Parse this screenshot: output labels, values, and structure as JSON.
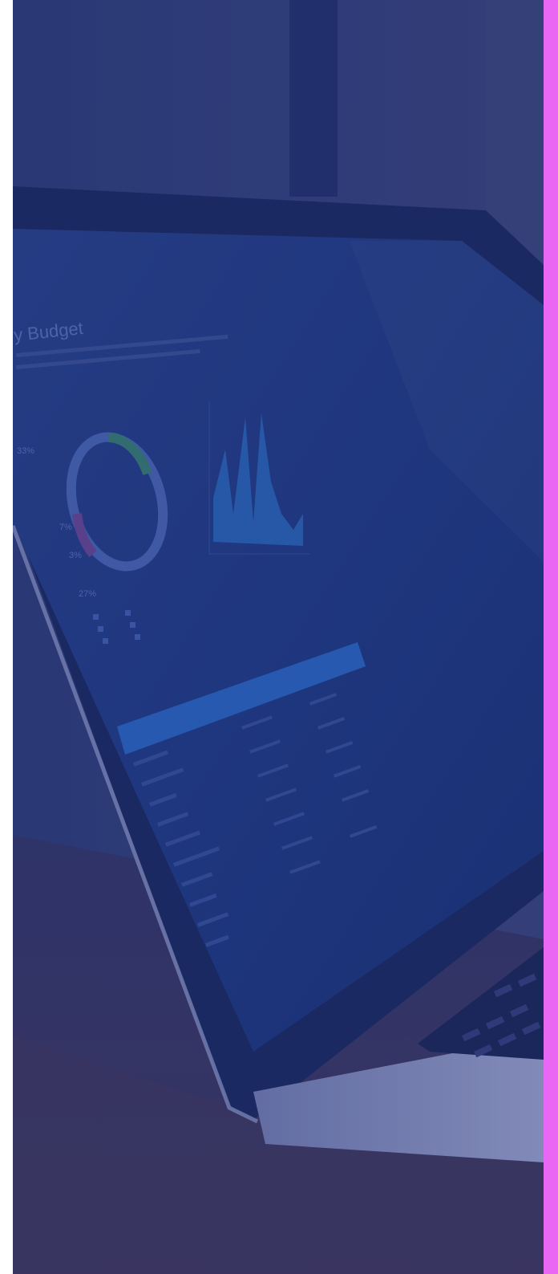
{
  "photo": {
    "alt_subject": "laptop-budget-screen",
    "screen": {
      "title": "y Budget",
      "percent_labels": [
        "33%",
        "7%",
        "3%",
        "27%"
      ]
    },
    "colors": {
      "overlay": "#1a286e",
      "accent_strip": "#ea67f4",
      "background": "#ffffff"
    }
  }
}
